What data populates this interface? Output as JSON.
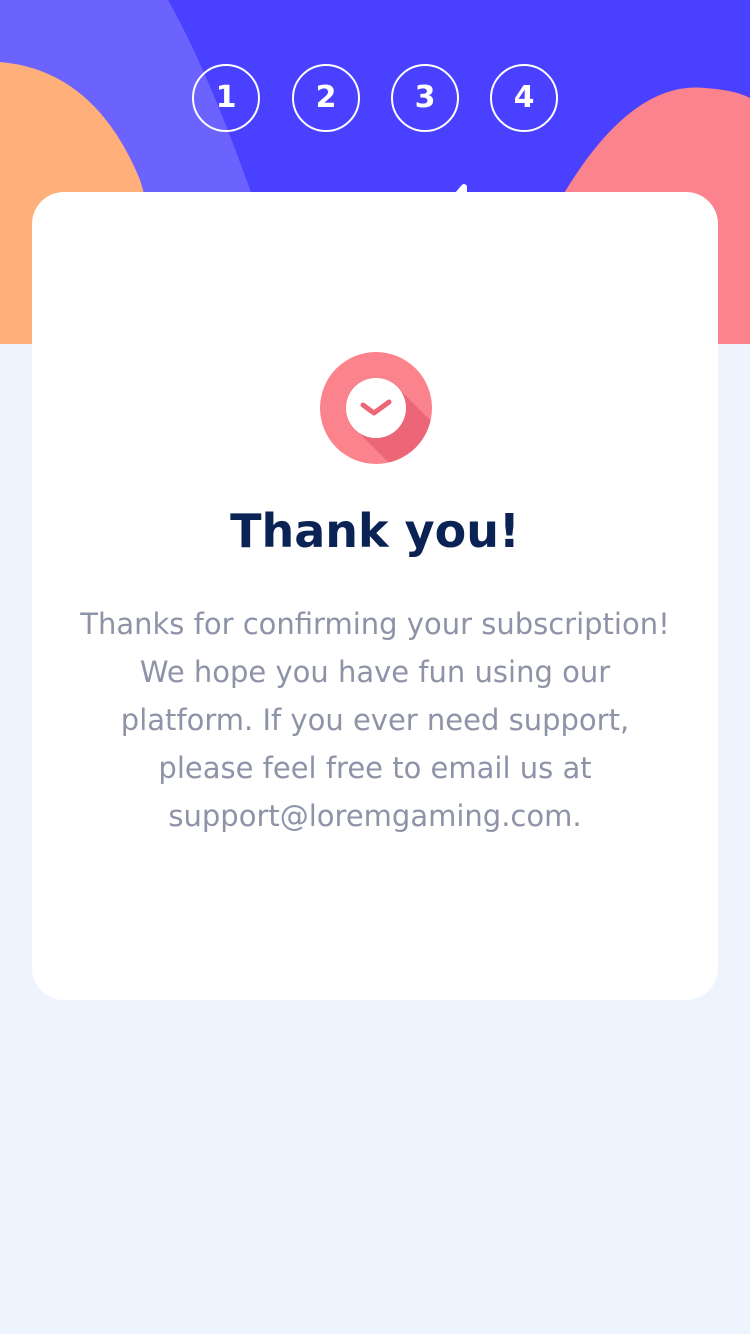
{
  "colors": {
    "hero_blue": "#4a40ff",
    "hero_light_blue": "#6c63ff",
    "orange_blob": "#ffb07a",
    "pink_blob": "#fb838d",
    "title": "#0b2255",
    "body_text": "#8e93a8",
    "page_bg": "#eef4fe"
  },
  "steps": [
    {
      "label": "1"
    },
    {
      "label": "2"
    },
    {
      "label": "3"
    },
    {
      "label": "4"
    }
  ],
  "confirmation": {
    "icon": "check-circle-icon",
    "title": "Thank you!",
    "message": "Thanks for confirming your subscription! We hope you have fun using our platform. If you ever need support, please feel free to email us at support@loremgaming.com."
  }
}
